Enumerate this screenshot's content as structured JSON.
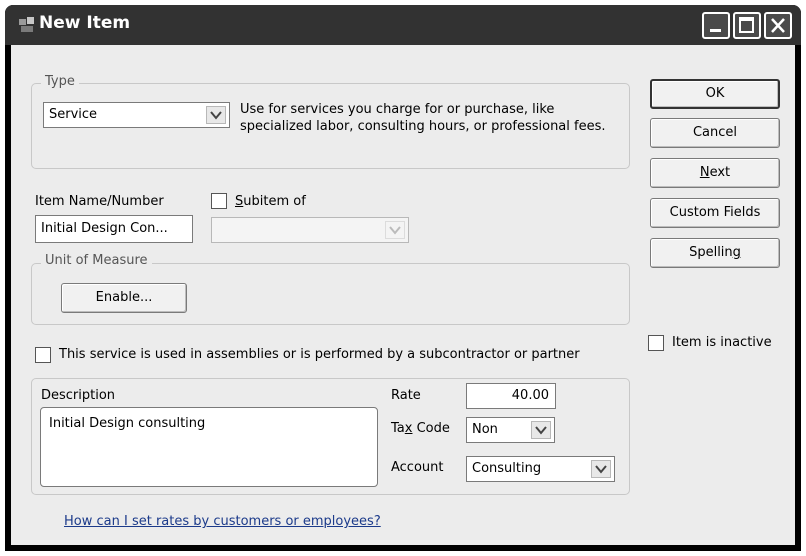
{
  "window": {
    "title": "New Item"
  },
  "type_group": {
    "label": "Type",
    "selected": "Service",
    "description": "Use for services you charge for or purchase, like specialized labor, consulting hours, or professional fees."
  },
  "item": {
    "name_label": "Item Name/Number",
    "name_value": "Initial Design Con...",
    "subitem_label": "Subitem of",
    "subitem_value": ""
  },
  "unit_of_measure": {
    "label": "Unit of Measure",
    "enable_label": "Enable..."
  },
  "assembly_checkbox_label": "This service is used in assemblies or is performed by a subcontractor or partner",
  "details": {
    "description_label": "Description",
    "description_value": "Initial Design consulting",
    "rate_label": "Rate",
    "rate_value": "40.00",
    "tax_code_label": "Tax Code",
    "tax_code_value": "Non",
    "account_label": "Account",
    "account_value": "Consulting"
  },
  "help_link": "How can I set rates by customers or employees?",
  "buttons": {
    "ok": "OK",
    "cancel": "Cancel",
    "next": "Next",
    "custom_fields": "Custom Fields",
    "spelling": "Spelling"
  },
  "inactive_label": "Item is inactive",
  "colors": {
    "titlebar": "#323232",
    "client": "#ececec",
    "link": "#1b3a8a"
  }
}
